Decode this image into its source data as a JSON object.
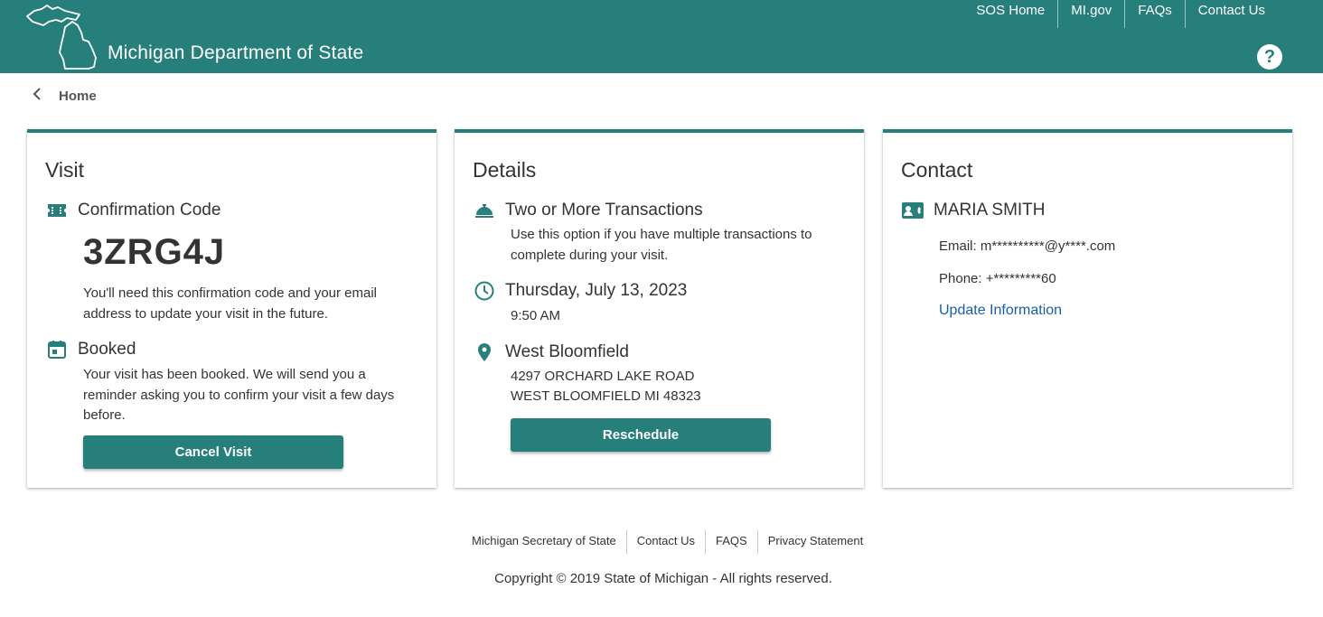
{
  "header": {
    "title": "Michigan Department of State",
    "nav": [
      "SOS Home",
      "MI.gov",
      "FAQs",
      "Contact Us"
    ],
    "help_label": "?",
    "logo_icon": "michigan-map-outline",
    "bg_color": "#267f7a"
  },
  "breadcrumb": {
    "label": "Home"
  },
  "visit": {
    "heading": "Visit",
    "code_label": "Confirmation Code",
    "code": "3ZRG4J",
    "code_note": "You'll need this confirmation code and your email address to update your visit in the future.",
    "status_label": "Booked",
    "status_note": "Your visit has been booked. We will send you a reminder asking you to confirm your visit a few days before.",
    "cancel_label": "Cancel Visit"
  },
  "details": {
    "heading": "Details",
    "service_title": "Two or More Transactions",
    "service_note": "Use this option if you have multiple transactions to complete during your visit.",
    "date": "Thursday, July 13, 2023",
    "time": "9:50 AM",
    "location_name": "West Bloomfield",
    "address_line1": "4297 ORCHARD LAKE ROAD",
    "address_line2": "WEST BLOOMFIELD MI 48323",
    "reschedule_label": "Reschedule"
  },
  "contact": {
    "heading": "Contact",
    "name": "MARIA SMITH",
    "email": "Email: m**********@y****.com",
    "phone": "Phone: +*********60",
    "update_label": "Update Information"
  },
  "footer": {
    "links": [
      "Michigan Secretary of State",
      "Contact Us",
      "FAQS",
      "Privacy Statement"
    ],
    "copyright": "Copyright © 2019 State of Michigan - All rights reserved."
  },
  "colors": {
    "accent": "#267f7a",
    "link": "#1a5ea8"
  }
}
